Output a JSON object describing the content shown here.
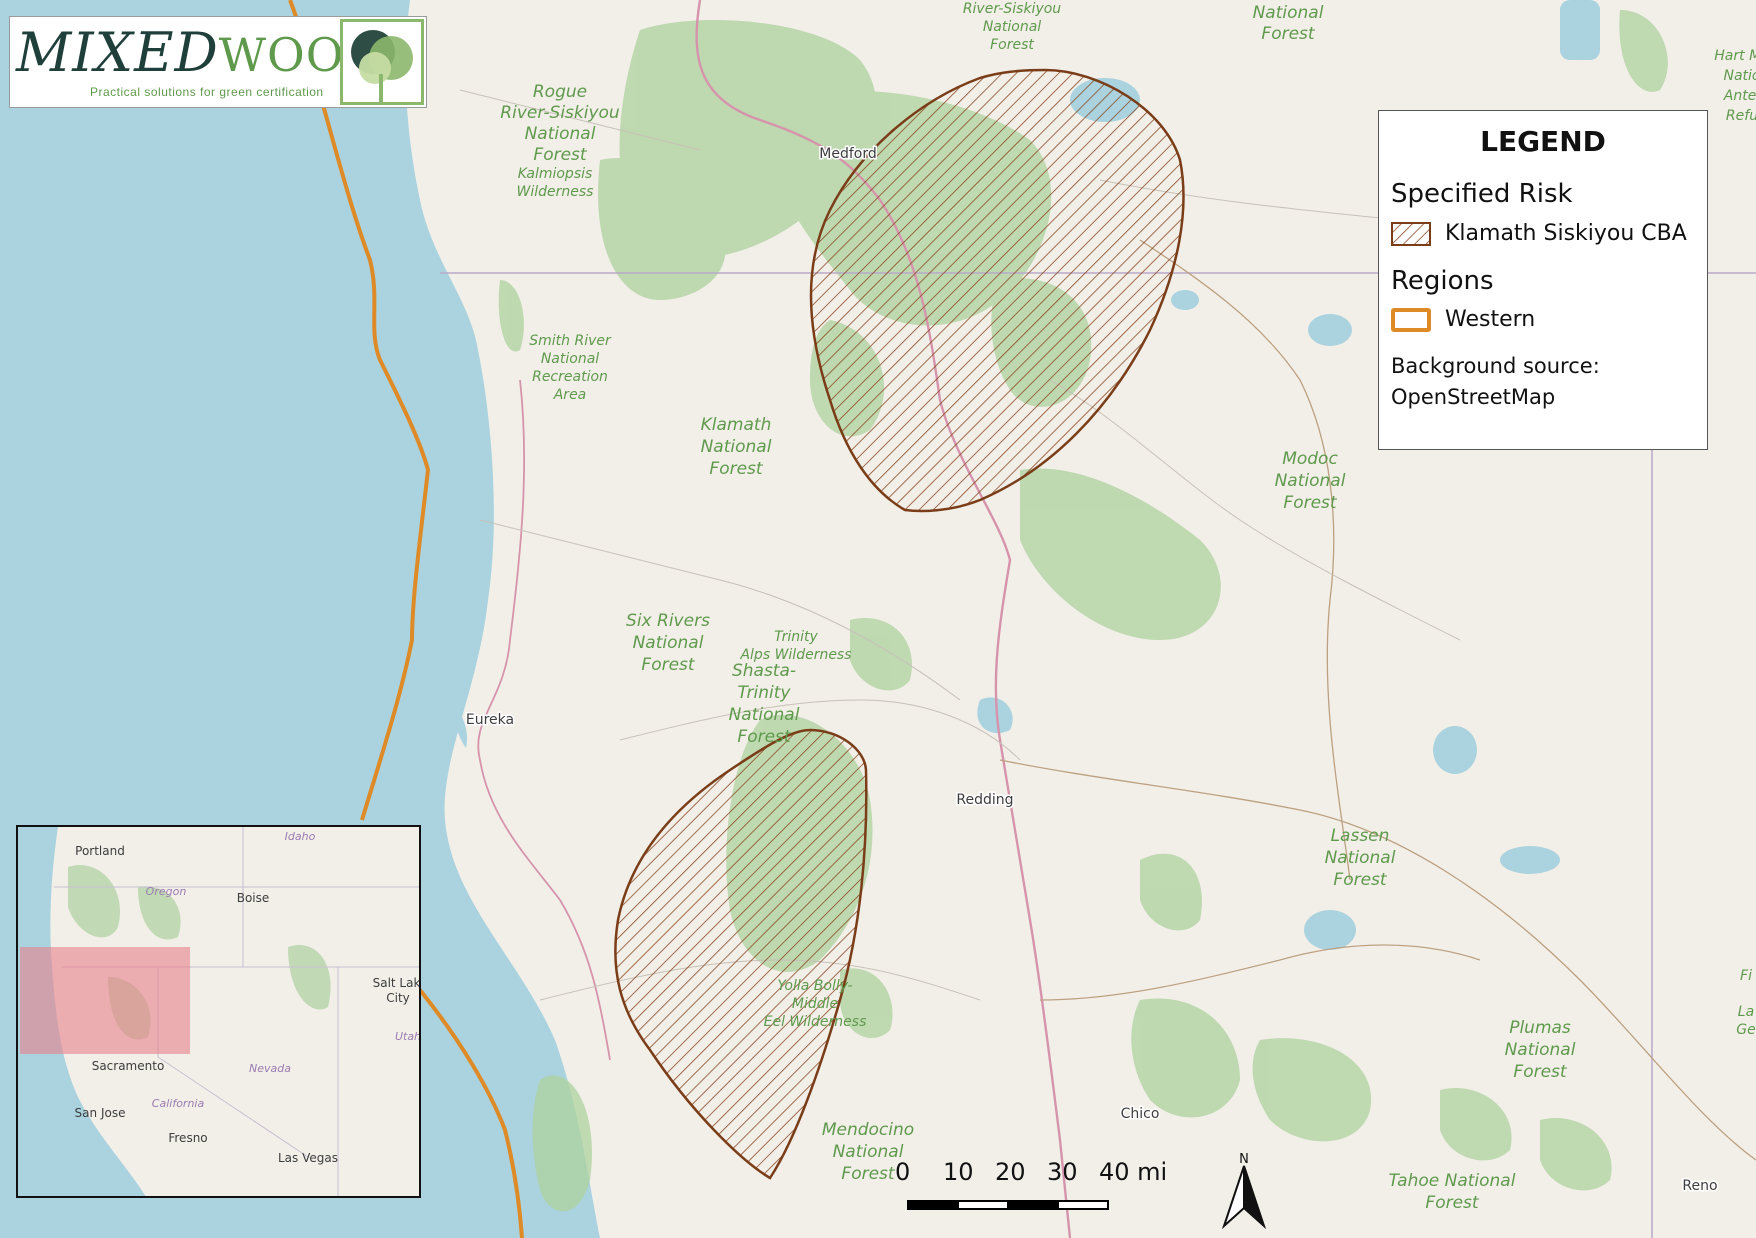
{
  "logo": {
    "word_mixed": "MIXED",
    "word_wood": "WOOD",
    "tagline": "Practical solutions for green certification"
  },
  "legend": {
    "title": "LEGEND",
    "specified_risk_heading": "Specified Risk",
    "specified_risk_item": "Klamath Siskiyou CBA",
    "regions_heading": "Regions",
    "regions_item": "Western",
    "source_line1": "Background source:",
    "source_line2": "OpenStreetMap"
  },
  "colors": {
    "water": "#aad3df",
    "land": "#f2efe9",
    "forest": "#add19e",
    "forest_label": "#5f9a4c",
    "hatch": "#8b4a22",
    "region_outline": "#de8a27",
    "inset_extent": "#e8818a"
  },
  "map_labels": {
    "forests": [
      {
        "lines": [
          "River-Siskiyou",
          "National",
          "Forest"
        ]
      },
      {
        "lines": [
          "National",
          "Forest"
        ]
      },
      {
        "lines": [
          "Hart Mo",
          "Natio",
          "Antel",
          "Refu"
        ]
      },
      {
        "lines": [
          "Rogue",
          "River-Siskiyou",
          "National",
          "Forest"
        ]
      },
      {
        "lines": [
          "Kalmiopsis",
          "Wilderness"
        ]
      },
      {
        "lines": [
          "Smith River",
          "National",
          "Recreation",
          "Area"
        ]
      },
      {
        "lines": [
          "Klamath",
          "National",
          "Forest"
        ]
      },
      {
        "lines": [
          "Modoc",
          "National",
          "Forest"
        ]
      },
      {
        "lines": [
          "Six Rivers",
          "National",
          "Forest"
        ]
      },
      {
        "lines": [
          "Trinity",
          "Alps Wilderness"
        ]
      },
      {
        "lines": [
          "Shasta-",
          "Trinity",
          "National",
          "Forest"
        ]
      },
      {
        "lines": [
          "Lassen",
          "National",
          "Forest"
        ]
      },
      {
        "lines": [
          "Yolla Bolly-",
          "Middle",
          "Eel Wilderness"
        ]
      },
      {
        "lines": [
          "Plumas",
          "National",
          "Forest"
        ]
      },
      {
        "lines": [
          "Mendocino",
          "National",
          "Forest"
        ]
      },
      {
        "lines": [
          "Tahoe National",
          "Forest"
        ]
      },
      {
        "lines": [
          "Fi",
          "La",
          "Ge"
        ]
      }
    ],
    "cities": [
      "Medford",
      "Eureka",
      "Redding",
      "Chico",
      "Reno"
    ]
  },
  "inset": {
    "cities": [
      "Portland",
      "Boise",
      "Salt Lake",
      "City",
      "Sacramento",
      "San Jose",
      "Fresno",
      "Las Vegas"
    ],
    "states": [
      "Idaho",
      "Oregon",
      "Utah",
      "Nevada",
      "California"
    ]
  },
  "scale": {
    "ticks": [
      "0",
      "10",
      "20",
      "30",
      "40 mi"
    ]
  },
  "north": {
    "letter": "N"
  }
}
